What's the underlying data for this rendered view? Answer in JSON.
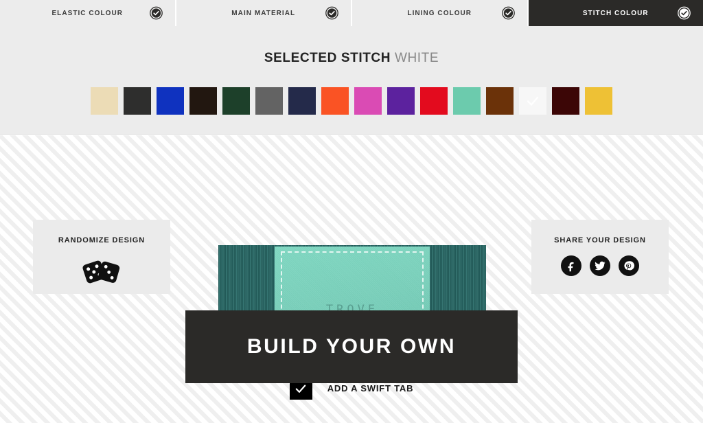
{
  "tabs": [
    {
      "label": "ELASTIC COLOUR",
      "icon": "check-circle-icon",
      "active": false
    },
    {
      "label": "MAIN MATERIAL",
      "icon": "check-circle-icon",
      "active": false
    },
    {
      "label": "LINING COLOUR",
      "icon": "check-circle-icon",
      "active": false
    },
    {
      "label": "STITCH COLOUR",
      "icon": "check-circle-icon",
      "active": true
    }
  ],
  "selector": {
    "title_strong": "SELECTED STITCH",
    "title_light": "WHITE",
    "swatches": [
      {
        "name": "cream",
        "color": "#ecdcb6",
        "selected": false
      },
      {
        "name": "charcoal",
        "color": "#2e2e2d",
        "selected": false
      },
      {
        "name": "royal-blue",
        "color": "#0f32bf",
        "selected": false
      },
      {
        "name": "dark-brown",
        "color": "#221710",
        "selected": false
      },
      {
        "name": "forest-green",
        "color": "#1d402a",
        "selected": false
      },
      {
        "name": "grey",
        "color": "#636363",
        "selected": false
      },
      {
        "name": "navy",
        "color": "#242a4a",
        "selected": false
      },
      {
        "name": "orange",
        "color": "#fa5324",
        "selected": false
      },
      {
        "name": "pink",
        "color": "#da4bb4",
        "selected": false
      },
      {
        "name": "purple",
        "color": "#5c229e",
        "selected": false
      },
      {
        "name": "red",
        "color": "#e30b1e",
        "selected": false
      },
      {
        "name": "mint",
        "color": "#6ccbad",
        "selected": false
      },
      {
        "name": "brown",
        "color": "#6b3209",
        "selected": false
      },
      {
        "name": "white",
        "color": "#f7f7f7",
        "selected": true
      },
      {
        "name": "maroon",
        "color": "#3c0606",
        "selected": false
      },
      {
        "name": "yellow",
        "color": "#eec135",
        "selected": false
      }
    ]
  },
  "banner": {
    "text": "BUILD YOUR OWN"
  },
  "randomize": {
    "title": "RANDOMIZE DESIGN",
    "icon": "dice-icon"
  },
  "share": {
    "title": "SHARE YOUR DESIGN",
    "buttons": [
      {
        "name": "facebook-icon",
        "label": "Facebook"
      },
      {
        "name": "twitter-icon",
        "label": "Twitter"
      },
      {
        "name": "pinterest-icon",
        "label": "Pinterest"
      }
    ]
  },
  "product": {
    "brand": "TROVE"
  },
  "swift_tab": {
    "label": "ADD A SWIFT TAB",
    "checked": true
  }
}
